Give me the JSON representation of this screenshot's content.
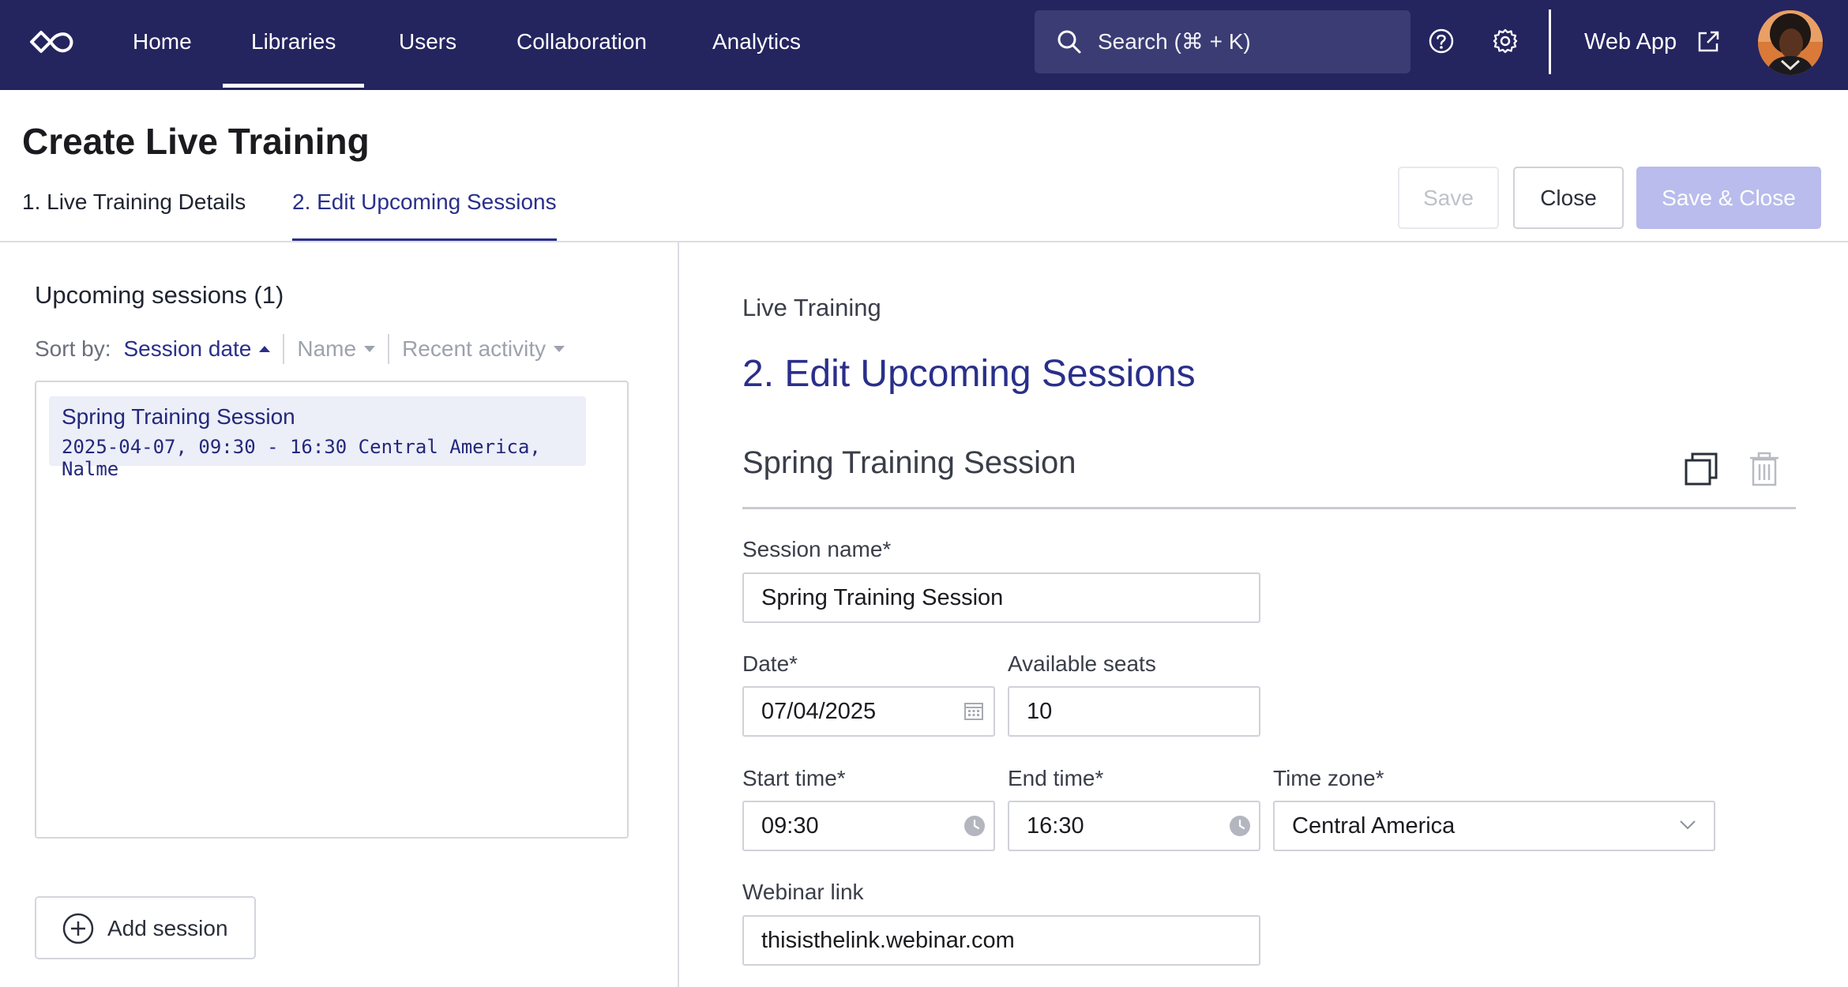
{
  "nav": {
    "items": [
      "Home",
      "Libraries",
      "Users",
      "Collaboration",
      "Analytics"
    ],
    "active": "Libraries",
    "search_placeholder": "Search (⌘ + K)",
    "webapp_label": "Web App",
    "icons": [
      "infinity-logo-icon",
      "search-icon",
      "help-icon",
      "gear-icon",
      "external-link-icon"
    ]
  },
  "page": {
    "title": "Create Live Training",
    "tabs": [
      "1. Live Training Details",
      "2. Edit Upcoming Sessions"
    ],
    "active_tab": "2. Edit Upcoming Sessions",
    "buttons": {
      "save": "Save",
      "close": "Close",
      "save_close": "Save & Close"
    }
  },
  "sessions": {
    "title": "Upcoming sessions (1)",
    "sort_label": "Sort by:",
    "sort_options": [
      "Session date",
      "Name",
      "Recent activity"
    ],
    "active_sort": "Session date",
    "items": [
      {
        "name": "Spring Training Session",
        "meta": "2025-04-07, 09:30 - 16:30 Central America, Nalme"
      }
    ],
    "add_label": "Add session"
  },
  "editor": {
    "section": "Live Training",
    "heading": "2. Edit Upcoming Sessions",
    "session_title": "Spring Training Session",
    "fields": {
      "session_name": {
        "label": "Session name*",
        "value": "Spring Training Session"
      },
      "date": {
        "label": "Date*",
        "value": "07/04/2025"
      },
      "seats": {
        "label": "Available seats",
        "value": "10"
      },
      "start": {
        "label": "Start time*",
        "value": "09:30"
      },
      "end": {
        "label": "End time*",
        "value": "16:30"
      },
      "timezone": {
        "label": "Time zone*",
        "value": "Central America"
      },
      "webinar": {
        "label": "Webinar link",
        "value": "thisisthelink.webinar.com"
      }
    }
  },
  "colors": {
    "nav_bg": "#24245f",
    "accent": "#2a2f8a",
    "disabled_primary": "#b9bcec"
  }
}
